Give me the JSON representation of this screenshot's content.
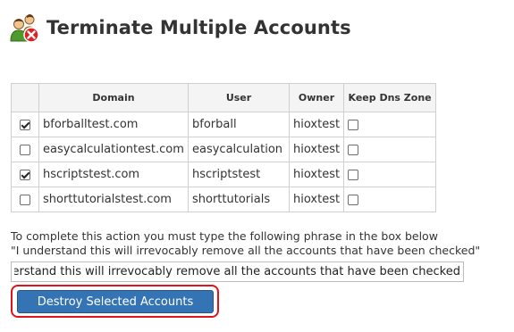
{
  "page": {
    "title": "Terminate Multiple Accounts",
    "icon": "users-remove-icon"
  },
  "table": {
    "headers": {
      "select": "",
      "domain": "Domain",
      "user": "User",
      "owner": "Owner",
      "keep_dns": "Keep Dns Zone"
    },
    "rows": [
      {
        "selected": true,
        "domain": "bforballtest.com",
        "user": "bforball",
        "owner": "hioxtest",
        "keep_dns": false
      },
      {
        "selected": false,
        "domain": "easycalculationtest.com",
        "user": "easycalculation",
        "owner": "hioxtest",
        "keep_dns": false
      },
      {
        "selected": true,
        "domain": "hscriptstest.com",
        "user": "hscriptstest",
        "owner": "hioxtest",
        "keep_dns": false
      },
      {
        "selected": false,
        "domain": "shorttutorialstest.com",
        "user": "shorttutorials",
        "owner": "hioxtest",
        "keep_dns": false
      }
    ]
  },
  "confirmation": {
    "instruction_line1": "To complete this action you must type the following phrase in the box below",
    "instruction_line2": "\"I understand this will irrevocably remove all the accounts that have been checked\"",
    "input_value": "I understand this will irrevocably remove all the accounts that have been checked"
  },
  "actions": {
    "destroy_label": "Destroy Selected Accounts"
  },
  "colors": {
    "button_bg": "#3474b4",
    "highlight_outline": "#e0141c"
  }
}
